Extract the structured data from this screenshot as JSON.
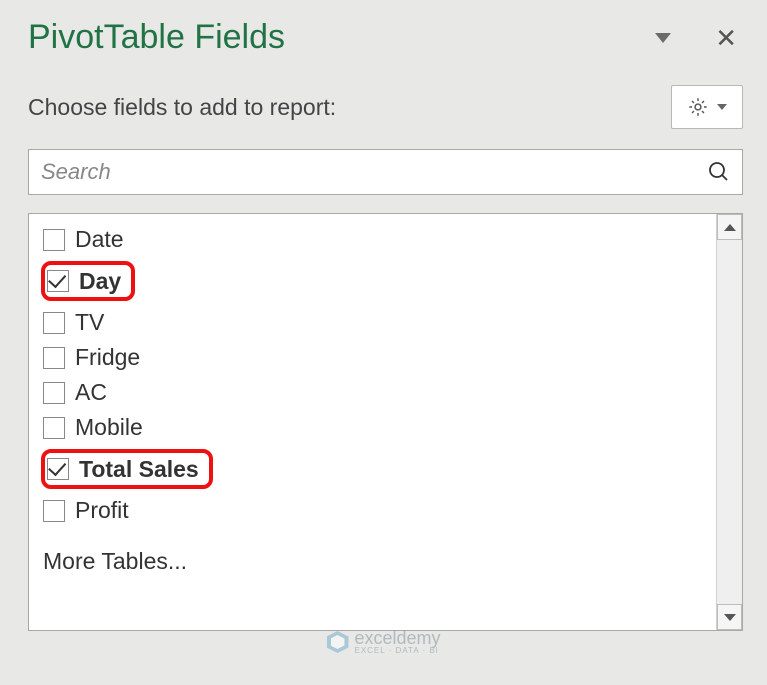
{
  "header": {
    "title": "PivotTable Fields",
    "subtitle": "Choose fields to add to report:"
  },
  "search": {
    "placeholder": "Search",
    "value": ""
  },
  "fields": [
    {
      "label": "Date",
      "checked": false,
      "highlighted": false
    },
    {
      "label": "Day",
      "checked": true,
      "highlighted": true
    },
    {
      "label": "TV",
      "checked": false,
      "highlighted": false
    },
    {
      "label": "Fridge",
      "checked": false,
      "highlighted": false
    },
    {
      "label": "AC",
      "checked": false,
      "highlighted": false
    },
    {
      "label": "Mobile",
      "checked": false,
      "highlighted": false
    },
    {
      "label": "Total Sales",
      "checked": true,
      "highlighted": true
    },
    {
      "label": "Profit",
      "checked": false,
      "highlighted": false
    }
  ],
  "more_tables_label": "More Tables...",
  "watermark": {
    "brand": "exceldemy",
    "tagline": "EXCEL · DATA · BI"
  }
}
